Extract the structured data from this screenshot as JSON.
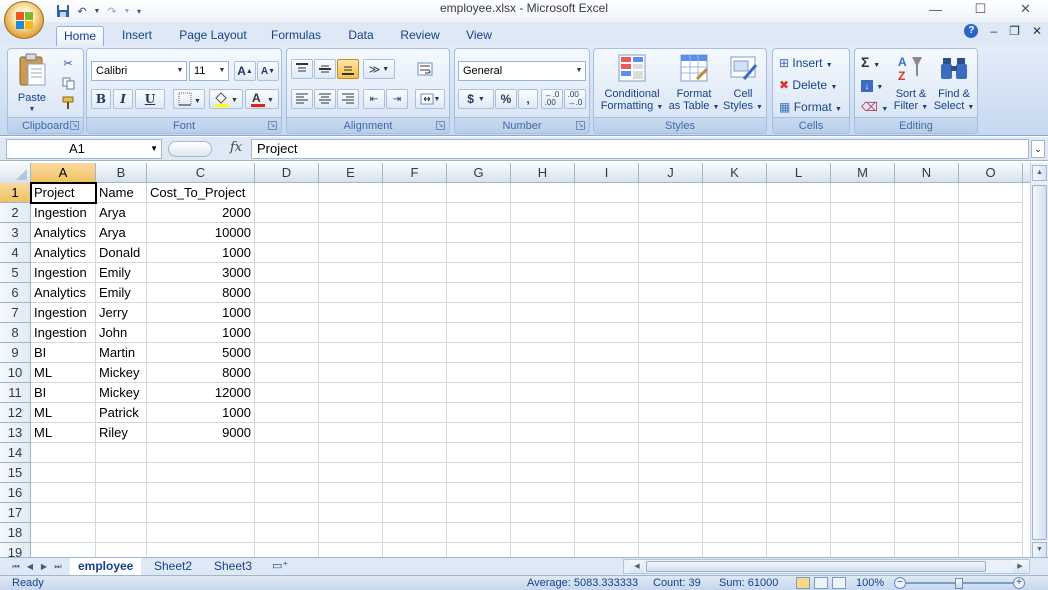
{
  "window": {
    "title": "employee.xlsx - Microsoft Excel",
    "minimize": "—",
    "maximize": "☐",
    "close": "✕"
  },
  "tabs": [
    "Home",
    "Insert",
    "Page Layout",
    "Formulas",
    "Data",
    "Review",
    "View"
  ],
  "active_tab": "Home",
  "ribbon": {
    "clipboard": {
      "title": "Clipboard",
      "paste": "Paste"
    },
    "font": {
      "title": "Font",
      "name": "Calibri",
      "size": "11",
      "bold": "B",
      "italic": "I",
      "underline": "U",
      "grow": "A",
      "shrink": "A"
    },
    "alignment": {
      "title": "Alignment"
    },
    "number": {
      "title": "Number",
      "format": "General",
      "currency": "$",
      "percent": "%",
      "comma": ","
    },
    "styles": {
      "title": "Styles",
      "cond_line1": "Conditional",
      "cond_line2": "Formatting",
      "fmt_line1": "Format",
      "fmt_line2": "as Table",
      "cell_line1": "Cell",
      "cell_line2": "Styles"
    },
    "cells": {
      "title": "Cells",
      "insert": "Insert",
      "delete": "Delete",
      "format": "Format"
    },
    "editing": {
      "title": "Editing",
      "sort_line1": "Sort &",
      "sort_line2": "Filter",
      "find_line1": "Find &",
      "find_line2": "Select"
    }
  },
  "formula_bar": {
    "name_box": "A1",
    "fx": "fx",
    "value": "Project"
  },
  "columns": [
    "A",
    "B",
    "C",
    "D",
    "E",
    "F",
    "G",
    "H",
    "I",
    "J",
    "K",
    "L",
    "M",
    "N",
    "O"
  ],
  "rows": [
    "1",
    "2",
    "3",
    "4",
    "5",
    "6",
    "7",
    "8",
    "9",
    "10",
    "11",
    "12",
    "13",
    "14",
    "15",
    "16",
    "17",
    "18",
    "19"
  ],
  "sheet": {
    "headers": [
      "Project",
      "Name",
      "Cost_To_Project"
    ],
    "data": [
      [
        "Ingestion",
        "Arya",
        "2000"
      ],
      [
        "Analytics",
        "Arya",
        "10000"
      ],
      [
        "Analytics",
        "Donald",
        "1000"
      ],
      [
        "Ingestion",
        "Emily",
        "3000"
      ],
      [
        "Analytics",
        "Emily",
        "8000"
      ],
      [
        "Ingestion",
        "Jerry",
        "1000"
      ],
      [
        "Ingestion",
        "John",
        "1000"
      ],
      [
        "BI",
        "Martin",
        "5000"
      ],
      [
        "ML",
        "Mickey",
        "8000"
      ],
      [
        "BI",
        "Mickey",
        "12000"
      ],
      [
        "ML",
        "Patrick",
        "1000"
      ],
      [
        "ML",
        "Riley",
        "9000"
      ]
    ]
  },
  "sheet_tabs": [
    "employee",
    "Sheet2",
    "Sheet3"
  ],
  "active_sheet": "employee",
  "status": {
    "ready": "Ready",
    "average": "Average: 5083.333333",
    "count": "Count: 39",
    "sum": "Sum: 61000",
    "zoom": "100%"
  },
  "colors": {
    "selection_header": "#f1c15f",
    "ribbon": "#dfe9f5",
    "accent": "#15428b"
  }
}
